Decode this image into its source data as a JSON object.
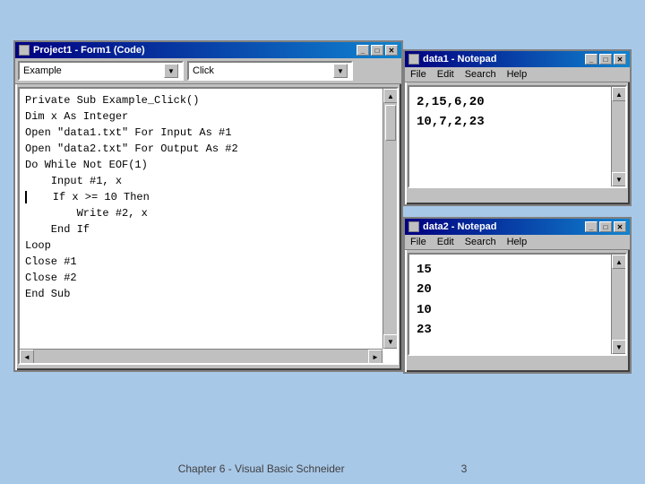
{
  "vb_window": {
    "title": "Project1 - Form1 (Code)",
    "dropdown1": "Example",
    "dropdown2": "Click",
    "code_lines": [
      "Private Sub Example_Click()",
      "Dim x As Integer",
      "Open \"data1.txt\" For Input As #1",
      "Open \"data2.txt\" For Output As #2",
      "Do While Not EOF(1)",
      "    Input #1, x",
      "    If x >= 10 Then",
      "        Write #2, x",
      "    End If",
      "Loop",
      "Close #1",
      "Close #2",
      "End Sub"
    ],
    "btn_min": "_",
    "btn_max": "□",
    "btn_close": "✕"
  },
  "notepad1": {
    "title": "data1 - Notepad",
    "menu": {
      "file": "File",
      "edit": "Edit",
      "search": "Search",
      "help": "Help"
    },
    "content": "2,15,6,20\n10,7,2,23",
    "btn_min": "_",
    "btn_max": "□",
    "btn_close": "✕"
  },
  "notepad2": {
    "title": "data2 - Notepad",
    "menu": {
      "file": "File",
      "edit": "Edit",
      "search": "Search",
      "help": "Help"
    },
    "content": "15\n20\n10\n23",
    "btn_min": "_",
    "btn_max": "□",
    "btn_close": "✕"
  },
  "caption": {
    "text": "Chapter 6 - Visual Basic    Schneider",
    "page": "3"
  }
}
